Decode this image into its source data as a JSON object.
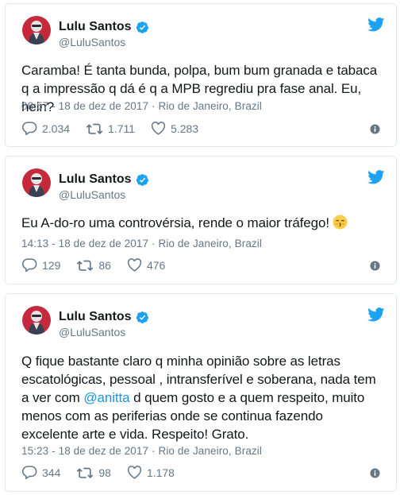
{
  "colors": {
    "link": "#1b95e0",
    "verified": "#1da1f2",
    "muted": "#657786",
    "text": "#14171a",
    "border": "#e1e8ed"
  },
  "icons": {
    "reply": "speech-bubble-icon",
    "retweet": "retweet-arrows-icon",
    "like": "heart-icon",
    "info": "info-circle-icon",
    "brand": "twitter-bird-icon",
    "verified": "verified-badge-icon"
  },
  "tweets": [
    {
      "author": {
        "name": "Lulu Santos",
        "handle": "@LuluSantos",
        "verified": true
      },
      "text": "Caramba! É tanta bunda, polpa, bum bum granada e tabaca q a impressão q dá é q a MPB regrediu pra fase anal. Eu, hein?",
      "time": "08:57 - 18 de dez de 2017",
      "separator": "·",
      "place": "Rio de Janeiro, Brazil",
      "replies": "2.034",
      "retweets": "1.711",
      "likes": "5.283"
    },
    {
      "author": {
        "name": "Lulu Santos",
        "handle": "@LuluSantos",
        "verified": true
      },
      "text": "Eu A-do-ro uma controvérsia, rende o maior tráfego!",
      "emoji": "kissing-face-emoji",
      "time": "14:13 - 18 de dez de 2017",
      "separator": "·",
      "place": "Rio de Janeiro, Brazil",
      "replies": "129",
      "retweets": "86",
      "likes": "476"
    },
    {
      "author": {
        "name": "Lulu Santos",
        "handle": "@LuluSantos",
        "verified": true
      },
      "text_before": "Q fique bastante claro q minha opinião sobre as letras escatológicas, pessoal , intransferível e soberana, nada tem a ver com ",
      "mention": "@anitta",
      "text_after": " d quem gosto e a quem respeito, muito menos com as periferias onde se continua fazendo excelente arte e vida. Respeito! Grato.",
      "time": "15:23 - 18 de dez de 2017",
      "separator": "·",
      "place": "Rio de Janeiro, Brazil",
      "replies": "344",
      "retweets": "98",
      "likes": "1.178"
    }
  ]
}
